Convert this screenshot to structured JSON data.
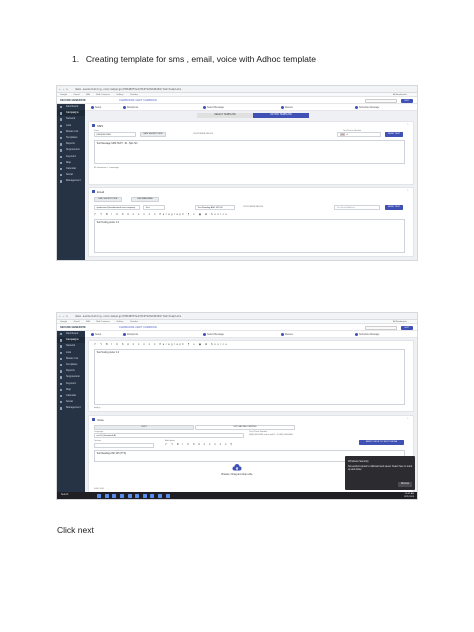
{
  "document": {
    "heading": "1.  Creating template for sms , email, voice with Adhoc template",
    "footer_note": "Click next"
  },
  "browser": {
    "url": "demo.aavmarketing.com/campaign/P00480f5e2d7b9f4d9d40d48/tab=template",
    "bookmarks": [
      "Google",
      "Gmail",
      "N/A",
      "Bulk Contacts",
      "Gallery",
      "Youtube"
    ],
    "bookmarks_right": "All Bookmarks"
  },
  "app": {
    "brand": "SECURE GENERATE",
    "breadcrumb": "CAMPAIGNS / EDIT CAMPAIGN",
    "exit_label": "EXIT",
    "sidebar": [
      "Dashboard",
      "Campaigns",
      "Network",
      "Lists",
      "Master List",
      "Templates",
      "Reports",
      "Suppression",
      "Keyword",
      "Map",
      "Calendar",
      "Social",
      "Management"
    ],
    "steps": [
      "Setup",
      "Recipients",
      "Select Message",
      "Review",
      "Schedule Message"
    ]
  },
  "shot1": {
    "template_tabs": [
      "SELECT TEMPLATE",
      "AD HOC TEMPLATE"
    ],
    "sms": {
      "title": "SMS",
      "from_label": "From",
      "from_value": "(000)000-0000",
      "sms_shortcode_btn": "SMS SHORTCODE",
      "customize_label": "CUSTOMIZE FIELDS",
      "phone_label": "Test Phone Number",
      "phone_value": "+1",
      "send_btn": "SEND TEST",
      "body": "Test Message SMS TEXT - ID - 5pts SO",
      "char_count": "89 characters • 1 message"
    },
    "email": {
      "title": "Email",
      "btn_1": "EML SHORTCODE",
      "btn_2": "USE MATERIAL",
      "from_value": "spiderman@nerdtestmail.com.company",
      "sender_value": "Test",
      "subject_value": "Test Reading ASK 425-56",
      "customize_label": "CUSTOMIZE FIELDS",
      "test_email_placeholder": "Test Email Address",
      "send_btn": "SEND TEST",
      "toolbar": "↶ ↷ B I U S A ≡ ≡ ≡ ≡ ≡ Paragraph ¶ ∞ ▣ ⊞ Source",
      "body": "Test Testing prefer 1.0"
    }
  },
  "shot2": {
    "toolbar": "↶ ↷ B I U S A ≡ ≡ ≡ ≡ ≡ Paragraph ¶ ∞ ▣ ⊞ Source",
    "body": "Test Testing prefer 1.0",
    "path": "body p",
    "voice": {
      "title": "Voice",
      "tab_1": "TEXT",
      "tab_2": "UPLOAD RECORDING",
      "select_value": "en-US (Standard-A)",
      "select_label": "Language",
      "test_label": "Test Phone Number",
      "test_value": "(000) 000-0000 ask to add 1 +1 (000) 000-0000",
      "send_btn": "SEND VOICE TO TEST PHONE",
      "options_label": "Options",
      "add_option_label": "Add option",
      "option_toolbar": "↶ ↷ B I U S A ≡ ≡ ≡ ≡ ≡ ¶",
      "text_body": "Test Reading ASK 425 (TTS)",
      "upload_text": "Browse / Drag and drop a file",
      "audio_text": "0:00 / 0:00"
    },
    "toast": {
      "title": "Windows Security",
      "body": "Screenshot copied to clipboard and saved. Select here to mark up and share.",
      "button": "Dismiss"
    },
    "taskbar_clock": "10:42 AM\n9/21/2023",
    "taskbar_search": "Search"
  }
}
